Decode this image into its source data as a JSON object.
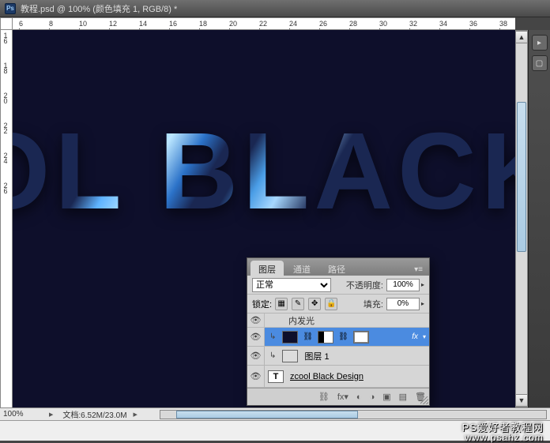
{
  "titlebar": {
    "doc_title": "教程.psd @ 100% (颜色填充 1, RGB/8) *",
    "app_icon_label": "Ps"
  },
  "ruler_top": [
    "6",
    "8",
    "10",
    "12",
    "14",
    "16",
    "18",
    "20",
    "22",
    "24",
    "26",
    "28",
    "30",
    "32",
    "34",
    "36",
    "38"
  ],
  "ruler_left": [
    "16",
    "18",
    "20",
    "22",
    "24",
    "26"
  ],
  "canvas_text": "OL BLACK",
  "statusbar": {
    "zoom": "100%",
    "doc_info": "文档:6.52M/23.0M"
  },
  "panel": {
    "tabs": [
      "图层",
      "通道",
      "路径"
    ],
    "blend_mode": "正常",
    "opacity_label": "不透明度:",
    "opacity_value": "100%",
    "lock_label": "锁定:",
    "fill_label": "填充:",
    "fill_value": "0%",
    "effect_innerglow": "内发光",
    "fx_label": "fx",
    "layer1_name": "图层 1",
    "text_layer_name": "zcool Black Design",
    "color_fill_layer": "颜色填充 1"
  },
  "watermark": {
    "line1": "PS爱好者教程网",
    "line2": "www.psahz.com"
  }
}
